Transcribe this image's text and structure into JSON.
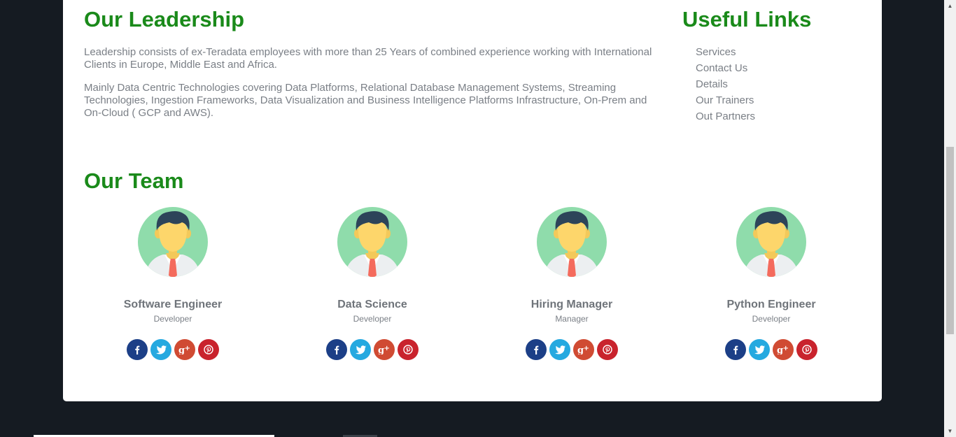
{
  "leadership": {
    "heading": "Our Leadership",
    "para1": "Leadership consists of ex-Teradata employees with more than 25 Years of combined experience working with International Clients in Europe, Middle East and Africa.",
    "para2": "Mainly Data Centric Technologies covering Data Platforms, Relational Database Management Systems, Streaming Technologies, Ingestion Frameworks, Data Visualization and Business Intelligence Platforms Infrastructure, On-Prem and On-Cloud ( GCP and AWS)."
  },
  "useful_links": {
    "heading": "Useful Links",
    "items": [
      "Services",
      "Contact Us",
      "Details",
      "Our Trainers",
      "Out Partners"
    ]
  },
  "team": {
    "heading": "Our Team",
    "members": [
      {
        "title": "Software Engineer",
        "role": "Developer"
      },
      {
        "title": "Data Science",
        "role": "Developer"
      },
      {
        "title": "Hiring Manager",
        "role": "Manager"
      },
      {
        "title": "Python Engineer",
        "role": "Developer"
      }
    ]
  },
  "social": {
    "facebook": {
      "icon": "facebook-icon",
      "color": "#1c3f87"
    },
    "twitter": {
      "icon": "twitter-icon",
      "color": "#25a9e0"
    },
    "google_plus": {
      "icon": "google-plus-icon",
      "color": "#d04b33"
    },
    "pinterest": {
      "icon": "pinterest-icon",
      "color": "#c9232d"
    }
  },
  "colors": {
    "heading": "#1a8a1a",
    "text": "#7a7f86",
    "background": "#151b22",
    "card": "#ffffff"
  }
}
